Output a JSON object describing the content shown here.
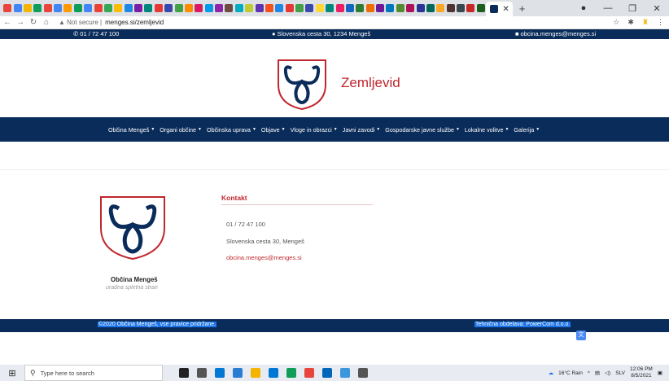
{
  "browser": {
    "tab_icon_colors": [
      "#e8453c",
      "#4285f4",
      "#f4b400",
      "#0f9d58",
      "#e8453c",
      "#4285f4",
      "#ff9900",
      "#0f9d58",
      "#4285f4",
      "#ea4335",
      "#34a853",
      "#fbbc05",
      "#1e88e5",
      "#7b1fa2",
      "#00897b",
      "#e53935",
      "#3949ab",
      "#43a047",
      "#fb8c00",
      "#d81b60",
      "#039be5",
      "#8e24aa",
      "#6d4c41",
      "#00acc1",
      "#c0ca33",
      "#5e35b1",
      "#f4511e",
      "#1e88e5",
      "#e53935",
      "#43a047",
      "#3949ab",
      "#fdd835",
      "#00897b",
      "#e91e63",
      "#1565c0",
      "#2e7d32",
      "#ef6c00",
      "#6a1b9a",
      "#0277bd",
      "#558b2f",
      "#ad1457",
      "#283593",
      "#00695c",
      "#f9a825",
      "#4e342e",
      "#37474f",
      "#c62828",
      "#1b5e20"
    ],
    "new_tab_label": "+",
    "back_icon": "arrow-left-icon",
    "forward_icon": "arrow-right-icon",
    "reload_icon": "reload-icon",
    "home_icon": "home-icon",
    "secure_text": "Not secure",
    "url": "menges.si/zemljevid"
  },
  "topbar": {
    "phone": "01 / 72 47 100",
    "address": "Slovenska cesta 30, 1234 Mengeš",
    "email": "obcina.menges@menges.si"
  },
  "header": {
    "title": "Zemljevid"
  },
  "nav": {
    "items": [
      {
        "label": "Občina Mengeš"
      },
      {
        "label": "Organi občine"
      },
      {
        "label": "Občinska uprava"
      },
      {
        "label": "Objave"
      },
      {
        "label": "Vloge in obrazci"
      },
      {
        "label": "Javni zavodi"
      },
      {
        "label": "Gospodarske javne službe"
      },
      {
        "label": "Lokalne volitve"
      },
      {
        "label": "Galerija"
      }
    ]
  },
  "org": {
    "name": "Občina Mengeš",
    "subtitle": "uradna spletna stran"
  },
  "contact": {
    "title": "Kontakt",
    "phone": "01 / 72 47 100",
    "address": "Slovenska cesta 30, Mengeš",
    "email": "obcina.menges@menges.si"
  },
  "footer": {
    "copyright": "©2020 Občina Mengeš, vse pravice pridržane.",
    "credit": "Tehnična obdelava: PowerCom d.o.o."
  },
  "taskbar": {
    "search_placeholder": "Type here to search",
    "weather": "16°C  Rain",
    "language": "SLV",
    "time": "12:06 PM",
    "date": "8/5/2021",
    "app_icon_colors": [
      "#222222",
      "#555555",
      "#0078d4",
      "#2b7cd3",
      "#f4b400",
      "#0078d4",
      "#0f9d58",
      "#e8453c",
      "#0067b8",
      "#3a96dd",
      "#555555"
    ]
  },
  "colors": {
    "brand_dark": "#0a2c5a",
    "accent_red": "#c0272d",
    "highlight": "#1a73e8"
  }
}
